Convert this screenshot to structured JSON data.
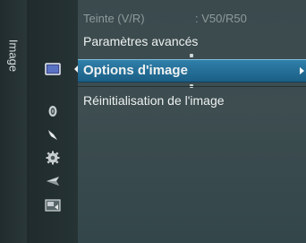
{
  "sidebar": {
    "title": "Image"
  },
  "icons": [
    {
      "name": "picture-icon",
      "active": true
    },
    {
      "name": "sound-icon",
      "active": false
    },
    {
      "name": "channel-icon",
      "active": false
    },
    {
      "name": "setup-icon",
      "active": false
    },
    {
      "name": "input-icon",
      "active": false
    },
    {
      "name": "application-icon",
      "active": false
    }
  ],
  "menu": {
    "tint_label": "Teinte (V/R)",
    "tint_value": ": V50/R50",
    "advanced_label": "Paramètres avancés",
    "options_label": "Options d'image",
    "reset_label": "Réinitialisation de l'image"
  },
  "colors": {
    "highlight": "#2172a0",
    "background": "#3a4a4d"
  }
}
